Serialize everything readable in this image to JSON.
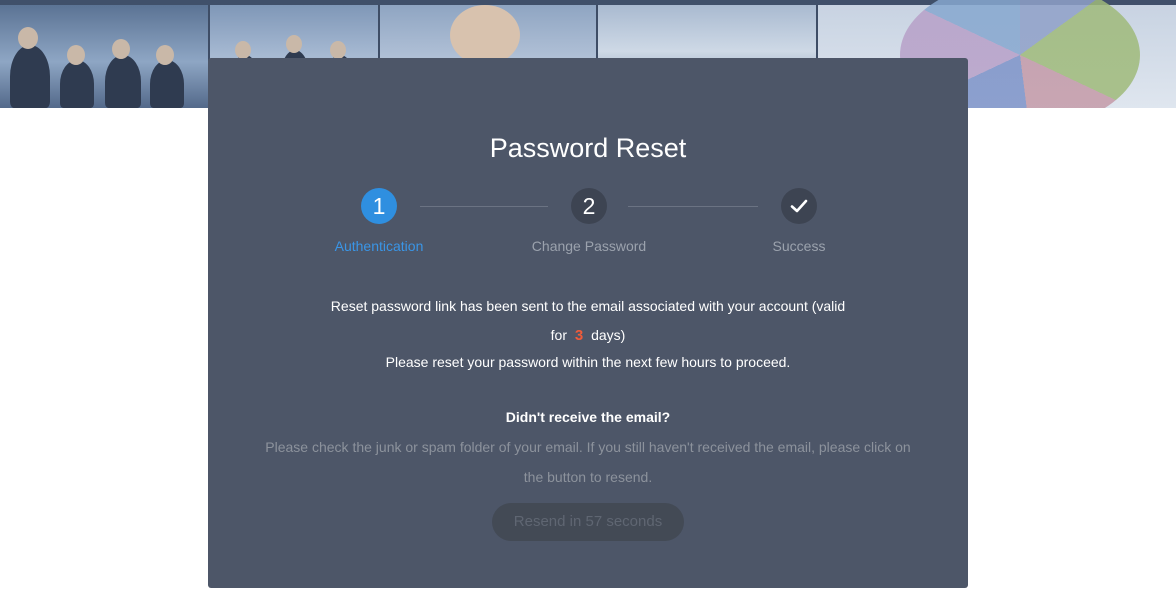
{
  "modal": {
    "title": "Password Reset"
  },
  "steps": [
    {
      "number": "1",
      "label": "Authentication",
      "state": "active"
    },
    {
      "number": "2",
      "label": "Change Password",
      "state": "pending"
    },
    {
      "icon": "check-icon",
      "label": "Success",
      "state": "pending"
    }
  ],
  "message": {
    "line1": "Reset password link has been sent to the email associated with your account (valid",
    "line2_prefix": "for",
    "days": "3",
    "line2_suffix": "days)",
    "line3": "Please reset your password within the next few hours to proceed."
  },
  "help": {
    "heading": "Didn't receive the email?",
    "text_line1": "Please check the junk or spam folder of your email. If you still haven't received the email, please click on",
    "text_line2": "the button to resend."
  },
  "resend_button": {
    "label": "Resend in 57 seconds",
    "enabled": false
  },
  "colors": {
    "accent": "#2f8fe0",
    "highlight": "#ef5b3a",
    "modal_bg": "#4d5668"
  }
}
